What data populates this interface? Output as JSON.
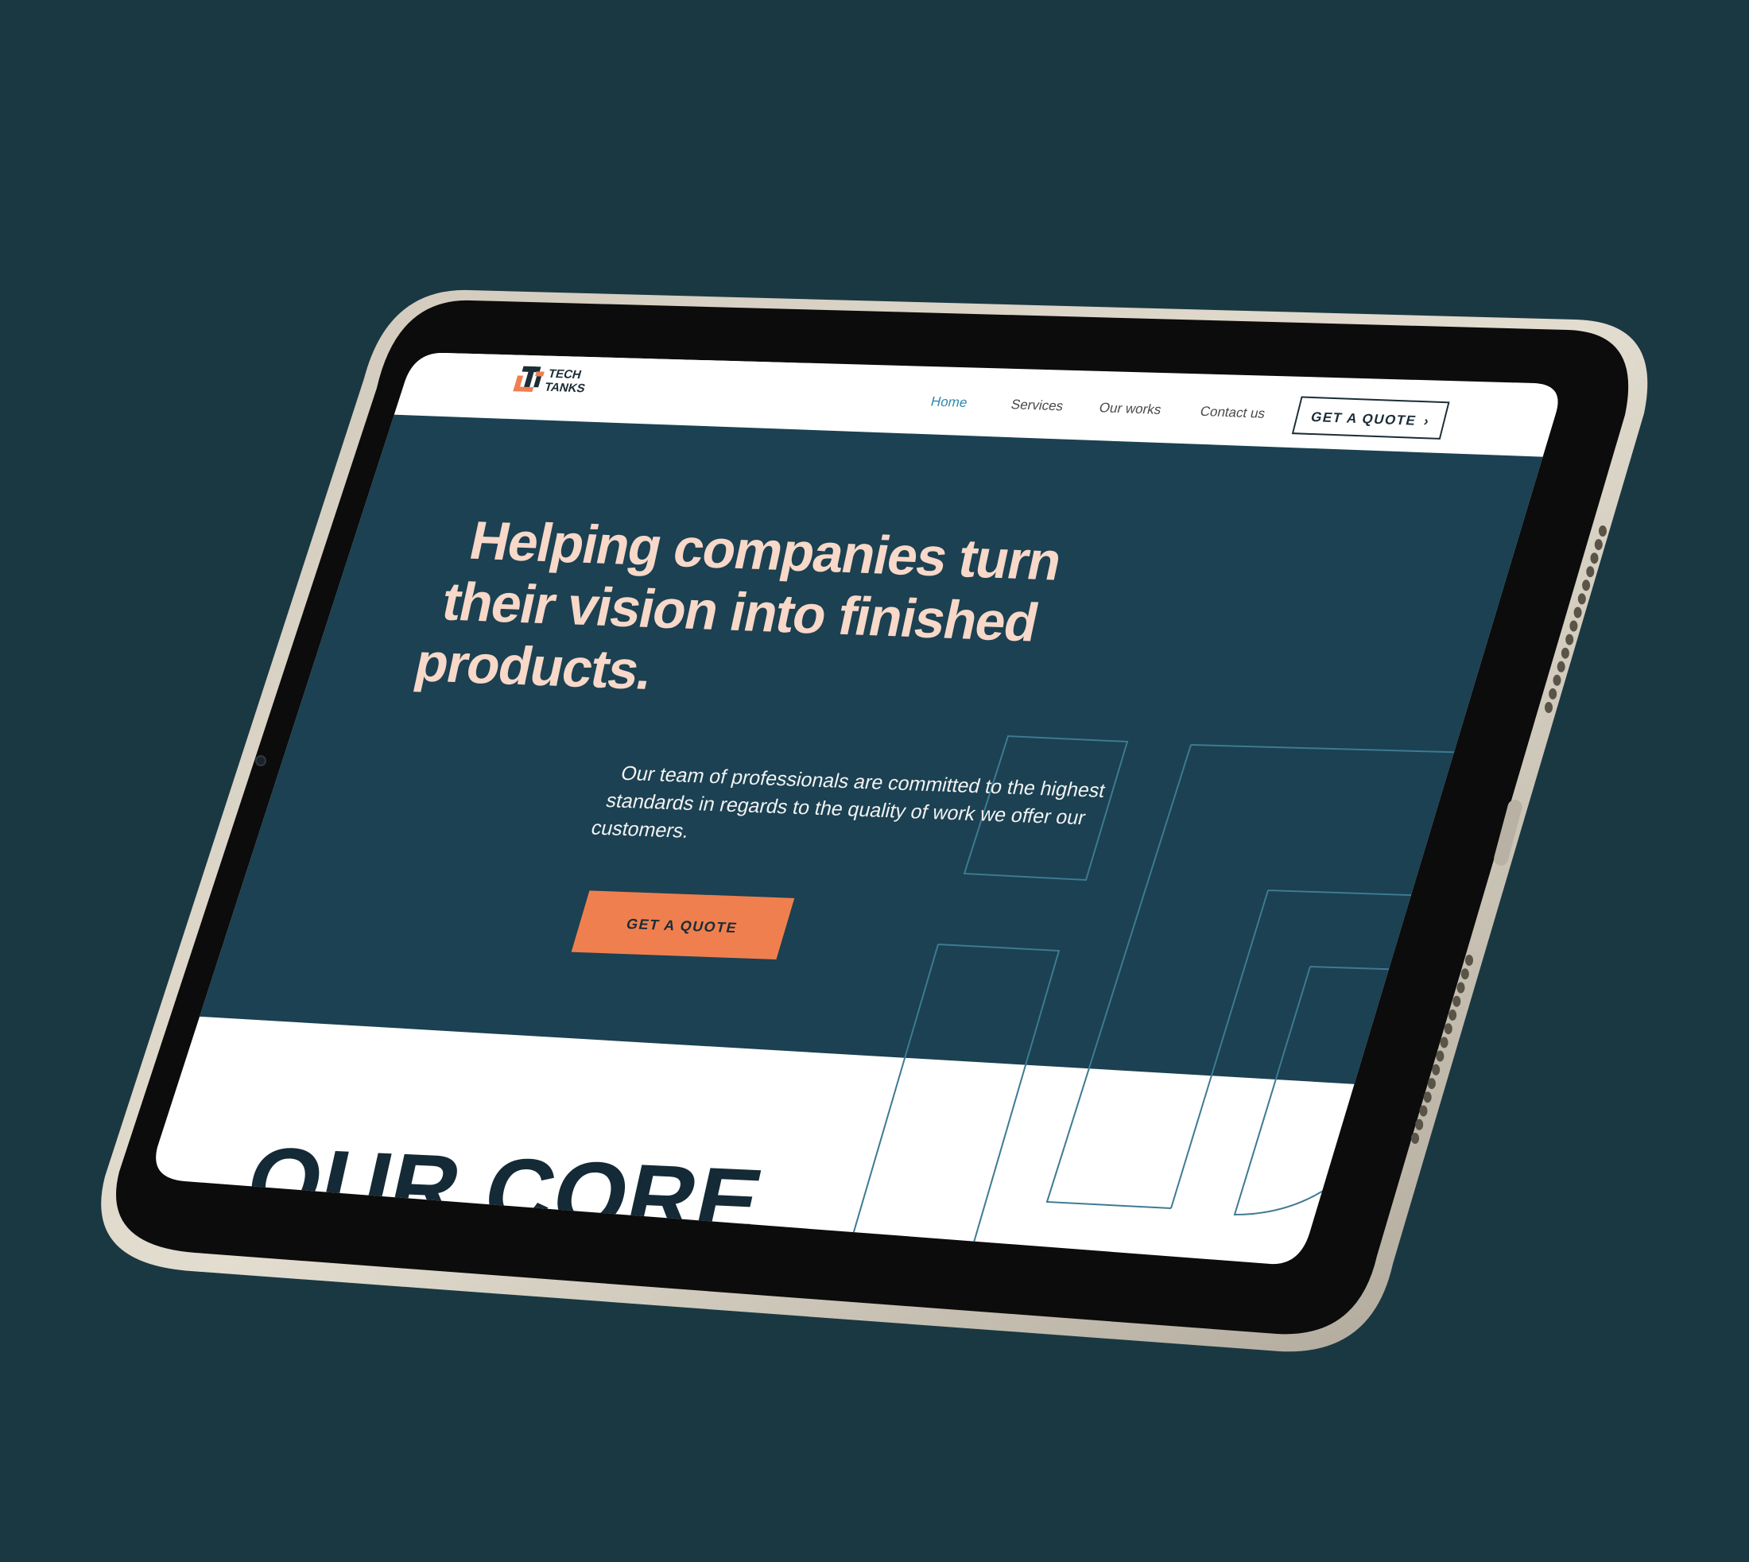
{
  "colors": {
    "page_background": "#1a3842",
    "device_frame": "#ddd6c8",
    "device_bezel": "#0c0c0c",
    "hero_background": "#1b4152",
    "headline": "#f8d8c8",
    "accent_orange": "#f07f4f",
    "nav_active": "#2f8ab0",
    "outline_lines": "#3e7a92"
  },
  "brand": {
    "logo_icon": "tech-tanks-logo-icon",
    "line1": "TECH",
    "line2": "TANKS"
  },
  "nav": {
    "items": [
      {
        "label": "Home",
        "active": true
      },
      {
        "label": "Services",
        "active": false
      },
      {
        "label": "Our works",
        "active": false
      },
      {
        "label": "Contact us",
        "active": false
      }
    ],
    "cta_label": "GET A QUOTE",
    "cta_icon": "chevron-right-icon"
  },
  "hero": {
    "headline_lines": [
      "Helping companies turn",
      "their vision into finished",
      "products."
    ],
    "body_lines": [
      "Our team of professionals are committed to the highest",
      "standards in regards to the quality of work we offer our",
      "customers."
    ],
    "cta_label": "GET A QUOTE"
  },
  "section": {
    "title": "OUR CORE"
  }
}
